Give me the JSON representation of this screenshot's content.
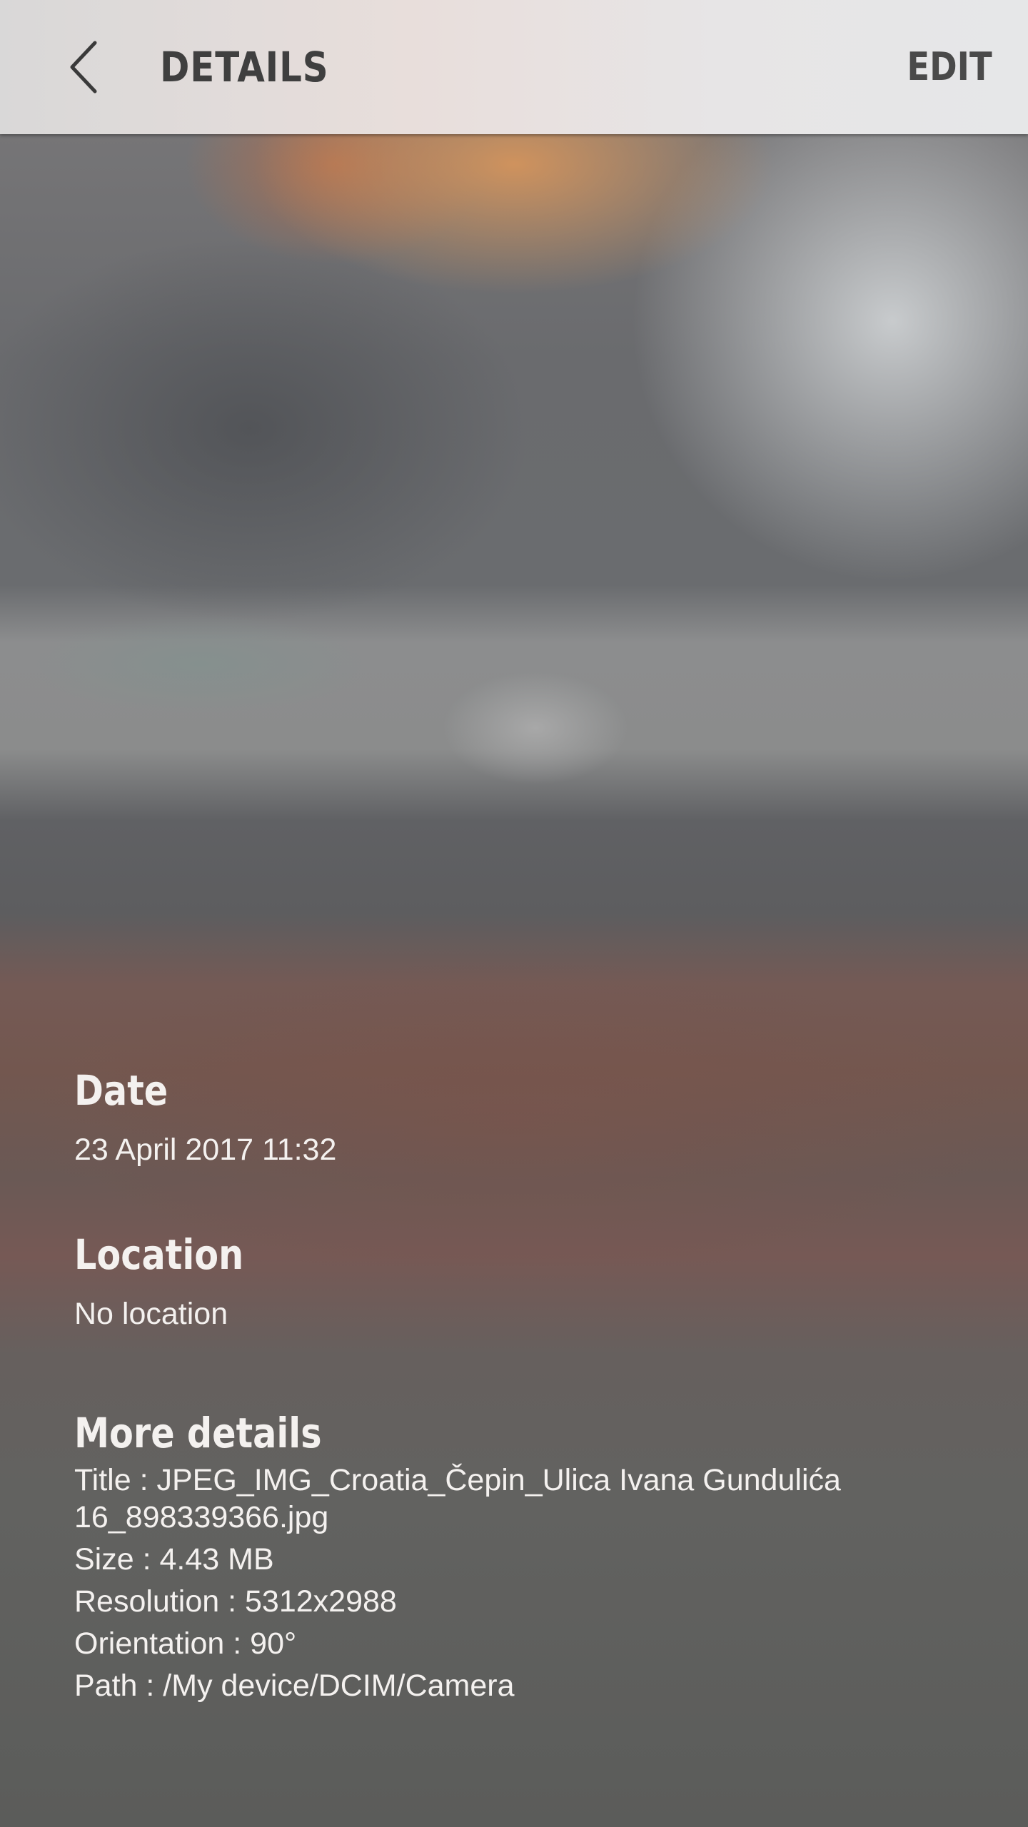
{
  "header": {
    "title": "DETAILS",
    "edit_label": "EDIT",
    "back_icon": "chevron-left-icon"
  },
  "sections": {
    "date": {
      "heading": "Date",
      "value": "23 April 2017 11:32"
    },
    "location": {
      "heading": "Location",
      "value": "No location"
    },
    "more_details": {
      "heading": "More details",
      "title": "Title : JPEG_IMG_Croatia_Čepin_Ulica Ivana Gundulića 16_898339366.jpg",
      "size": "Size : 4.43 MB",
      "resolution": "Resolution : 5312x2988",
      "orientation": "Orientation : 90°",
      "path": "Path : /My device/DCIM/Camera"
    }
  },
  "colors": {
    "app_bar": "#e6e3e2",
    "title_text": "#3f3f3f",
    "content_text": "#f4f1ef"
  }
}
